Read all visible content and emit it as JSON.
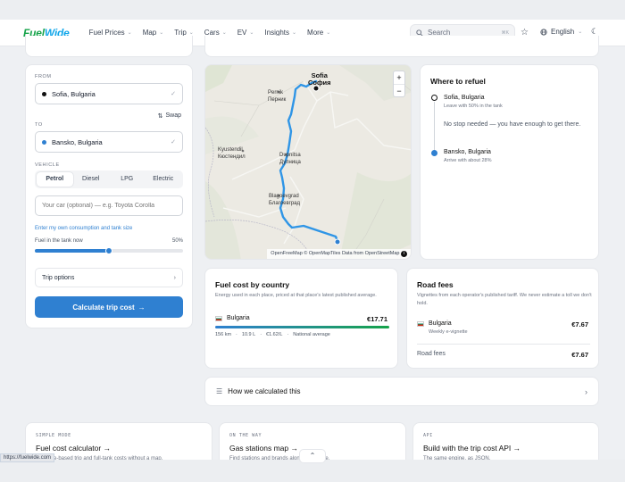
{
  "brand": {
    "part1": "Fuel",
    "part2": "Wide"
  },
  "nav": {
    "items": [
      {
        "label": "Fuel Prices",
        "chev": "⌄"
      },
      {
        "label": "Map",
        "chev": "⌄"
      },
      {
        "label": "Trip",
        "chev": "⌄"
      },
      {
        "label": "Cars",
        "chev": "⌄"
      },
      {
        "label": "EV",
        "chev": "⌄"
      },
      {
        "label": "Insights",
        "chev": "⌄"
      },
      {
        "label": "More",
        "chev": "⌄"
      }
    ],
    "search_placeholder": "Search",
    "search_kbd": "⌘K",
    "language": "English"
  },
  "planner": {
    "from_label": "FROM",
    "from_value": "Sofia, Bulgaria",
    "swap_label": "Swap",
    "to_label": "TO",
    "to_value": "Bansko, Bulgaria",
    "vehicle_label": "VEHICLE",
    "fuels": [
      "Petrol",
      "Diesel",
      "LPG",
      "Electric"
    ],
    "selected_fuel": 0,
    "car_placeholder": "Your car (optional) — e.g. Toyota Corolla",
    "consumption_link": "Enter my own consumption and tank size",
    "tank_label": "Fuel in the tank now",
    "tank_percent_label": "50%",
    "tank_fraction": 0.5,
    "trip_options": "Trip options",
    "calculate": "Calculate trip cost",
    "calc_arrow": "→"
  },
  "map": {
    "cities": [
      {
        "name": "Sofia",
        "alt": "София"
      },
      {
        "name": "Pernik",
        "alt": "Перник"
      },
      {
        "name": "Kyustendil",
        "alt": "Кюстендил"
      },
      {
        "name": "Dupnitsa",
        "alt": "Дупница"
      },
      {
        "name": "Blagoevgrad",
        "alt": "Благоевград"
      }
    ],
    "zoom_in": "+",
    "zoom_out": "−",
    "attribution": "OpenFreeMap © OpenMapTiles Data from OpenStreetMap"
  },
  "refuel": {
    "title": "Where to refuel",
    "start_place": "Sofia, Bulgaria",
    "start_note": "Leave with 50% in the tank",
    "middle_note": "No stop needed — you have enough to get there.",
    "end_place": "Bansko, Bulgaria",
    "end_note": "Arrive with about 28%"
  },
  "fuel_cost": {
    "title": "Fuel cost by country",
    "subtitle": "Energy used in each place, priced at that place's latest published average.",
    "country": "Bulgaria",
    "amount": "€17.71",
    "km": "156 km",
    "liters": "10.9 L",
    "price": "€1.62/L",
    "note": "National average",
    "sep": "·"
  },
  "road_fees": {
    "title": "Road fees",
    "subtitle": "Vignettes from each operator's published tariff. We never estimate a toll we don't hold.",
    "country": "Bulgaria",
    "type": "Weekly e-vignette",
    "amount": "€7.67",
    "total_label": "Road fees",
    "total_amount": "€7.67"
  },
  "how": {
    "title": "How we calculated this"
  },
  "promos": [
    {
      "tag": "SIMPLE MODE",
      "title": "Fuel cost calculator →",
      "desc": "Distance-based trip and full-tank costs without a map."
    },
    {
      "tag": "ON THE WAY",
      "title": "Gas stations map →",
      "desc": "Find stations and brands along your route."
    },
    {
      "tag": "API",
      "title": "Build with the trip cost API →",
      "desc": "The same engine, as JSON."
    }
  ],
  "status_url": "https://fuelwide.com",
  "colors": {
    "accent": "#2f80d1",
    "brand_green": "#16a34a",
    "route": "#2f95e6"
  }
}
